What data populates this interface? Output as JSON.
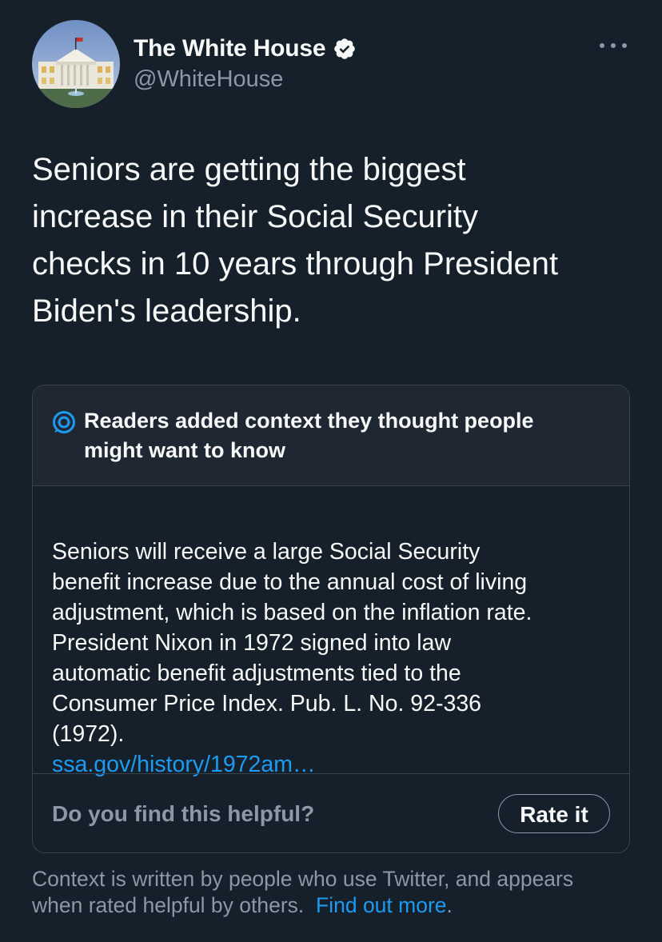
{
  "tweet": {
    "author": {
      "display_name": "The White House",
      "handle": "@WhiteHouse",
      "verified": true,
      "avatar_icon": "white-house-avatar-icon"
    },
    "more_icon": "ellipsis-icon",
    "text": "Seniors are getting the biggest\nincrease in their Social Security\nchecks in 10 years through President\nBiden's leadership."
  },
  "community_note": {
    "icon": "community-notes-icon",
    "title": "Readers added context they thought people\nmight want to know",
    "body": "Seniors will receive a large Social Security\nbenefit increase due to the annual cost of living\nadjustment, which is based on the inflation rate.\nPresident Nixon in 1972 signed into law\nautomatic benefit adjustments tied to the\nConsumer Price Index. Pub. L. No. 92-336\n(1972).",
    "link_text": "ssa.gov/history/1972am…",
    "helpful_question": "Do you find this helpful?",
    "rate_button_label": "Rate it"
  },
  "disclaimer": {
    "line1": "Context is written by people who use Twitter, and appears",
    "line2_prefix": "when rated helpful by others.",
    "link_text": "Find out more",
    "suffix": "."
  },
  "colors": {
    "background": "#15202b",
    "note_header_bg": "#1e2732",
    "border": "#38444d",
    "primary_text": "#f7f9f9",
    "secondary_text": "#8b98a5",
    "link": "#1d9bf0"
  }
}
